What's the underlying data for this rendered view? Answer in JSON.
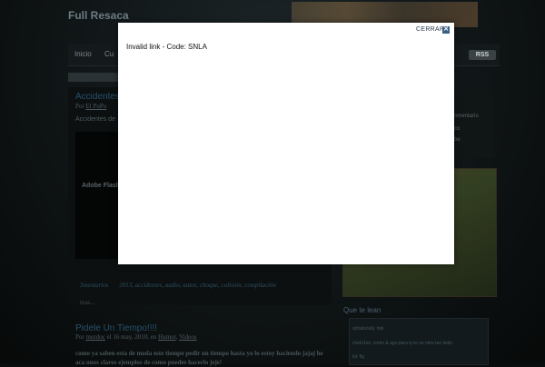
{
  "site": {
    "title": "Full Resaca"
  },
  "nav": {
    "items": [
      "Inicio",
      "Cu"
    ],
    "rss": "RSS"
  },
  "post1": {
    "title": "Accidentes",
    "meta_prefix": "Por",
    "author": "El PoPo",
    "excerpt": "Accidentes de",
    "flash_text": "Adobe Flash",
    "tags": [
      "3mentarios",
      "2013, accidentes, audio, autos, choque, colisión, compilación"
    ],
    "more": "mas..."
  },
  "post2": {
    "title": "Pidele Un Tiempo!!!!",
    "meta_prefix": "Por",
    "author": "murdoc",
    "date": "el 16 may, 2010, en",
    "cat1": "Humor",
    "cat2": "Videos",
    "excerpt": "como ya saben esta de moda este tiempo pedir un tiempo hasta yo lo estoy haciendo jajaj he aca unos claros ejemplos de como puedes hacerlo jeje!"
  },
  "sidebar": {
    "lines": [
      "omentario",
      "co",
      "be"
    ],
    "comments_heading": "Que te lean",
    "comments": [
      {
        "user": "ochaloca6j",
        "text": "holi"
      },
      {
        "user": "chelo1ez",
        "text": "como & ago para q no se mire tan lindo"
      },
      {
        "user": "lol",
        "text": "fig"
      }
    ]
  },
  "modal": {
    "close_label": "CERRAR",
    "close_icon": "close-icon",
    "message": "Invalid link - Code: SNLA"
  }
}
